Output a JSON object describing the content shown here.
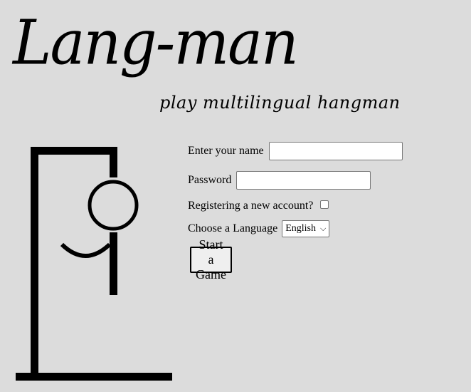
{
  "logo": {
    "title": "Lang-man",
    "subtitle": "play multilingual hangman"
  },
  "form": {
    "name_label": "Enter your name",
    "name_value": "",
    "password_label": "Password",
    "password_value": "",
    "register_label": "Registering a new account?",
    "register_checked": false,
    "language_label": "Choose a Language",
    "language_selected": "English",
    "start_button_label": "Start a Game"
  },
  "icons": {
    "gallows": "hangman-gallows-icon",
    "select_arrow": "chevron-down-icon"
  },
  "colors": {
    "background": "#dcdcdc",
    "ink": "#000000"
  }
}
